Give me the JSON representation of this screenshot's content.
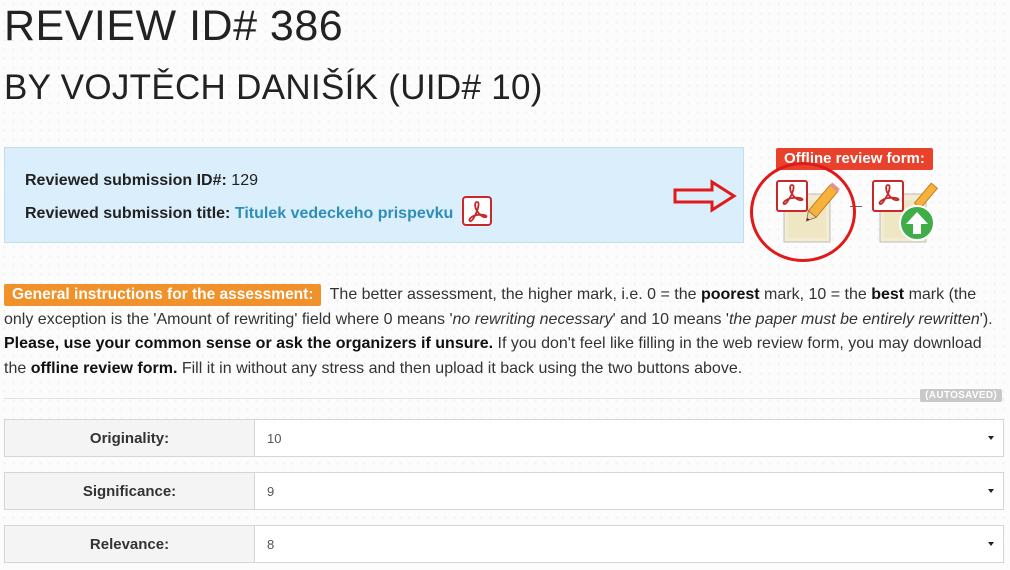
{
  "header": {
    "title": "REVIEW ID# 386",
    "subtitle": "BY VOJTĚCH DANIŠÍK (UID# 10)"
  },
  "submission": {
    "id_label": "Reviewed submission ID#:",
    "id_value": "129",
    "title_label": "Reviewed submission title:",
    "title_value": "Titulek vedeckeho prispevku"
  },
  "offline": {
    "label": "Offline review form:",
    "download_icon": "pdf-edit-icon",
    "upload_icon": "pdf-upload-icon"
  },
  "instructions": {
    "badge": "General instructions for the assessment:",
    "t1": " The better assessment, the higher mark, i.e. 0 = the ",
    "b1": "poorest",
    "t2": " mark, 10 = the ",
    "b2": "best",
    "t3": " mark (the only exception is the 'Amount of rewriting' field where 0 means '",
    "i1": "no rewriting necessary",
    "t4": "' and 10 means '",
    "i2": "the paper must be entirely rewritten",
    "t5": "'). ",
    "b3": "Please, use your common sense or ask the organizers if unsure.",
    "t6": " If you don't feel like filling in the web review form, you may download the ",
    "b4": "offline review form.",
    "t7": " Fill it in without any stress and then upload it back using the two buttons above."
  },
  "autosaved": "(AUTOSAVED)",
  "fields": [
    {
      "label": "Originality:",
      "value": "10"
    },
    {
      "label": "Significance:",
      "value": "9"
    },
    {
      "label": "Relevance:",
      "value": "8"
    }
  ],
  "colors": {
    "info_bg": "#dbeefc",
    "accent_red": "#e8412c",
    "instr_orange": "#f0912a",
    "link_blue": "#2e8fb6",
    "upload_green": "#3fae49"
  }
}
